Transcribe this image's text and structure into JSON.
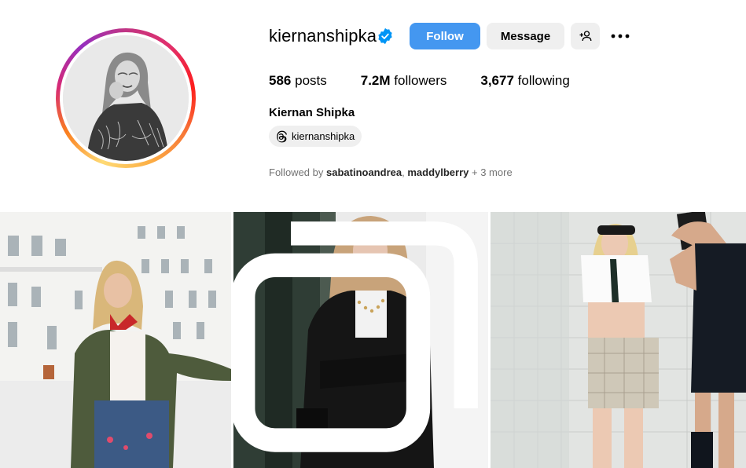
{
  "profile": {
    "username": "kiernanshipka",
    "full_name": "Kiernan Shipka",
    "verified": true,
    "posts_count": "586",
    "posts_label": "posts",
    "followers_count": "7.2M",
    "followers_label": "followers",
    "following_count": "3,677",
    "following_label": "following",
    "threads_handle": "kiernanshipka"
  },
  "actions": {
    "follow_label": "Follow",
    "message_label": "Message"
  },
  "followed_by": {
    "prefix": "Followed by",
    "user1": "sabatinoandrea",
    "separator": ",",
    "user2": "maddylberry",
    "suffix": "+ 3 more"
  },
  "colors": {
    "follow_blue": "#4497f0",
    "button_gray": "#efefef",
    "verified_blue": "#0095f6",
    "muted_text": "#737373"
  },
  "icons": {
    "verified": "verified-badge-icon",
    "add_user": "add-user-icon",
    "more": "more-options-icon",
    "threads": "threads-icon",
    "multi_post": "multi-photo-icon"
  },
  "posts": [
    {
      "id": "post-1"
    },
    {
      "id": "post-2"
    },
    {
      "id": "post-3"
    }
  ]
}
